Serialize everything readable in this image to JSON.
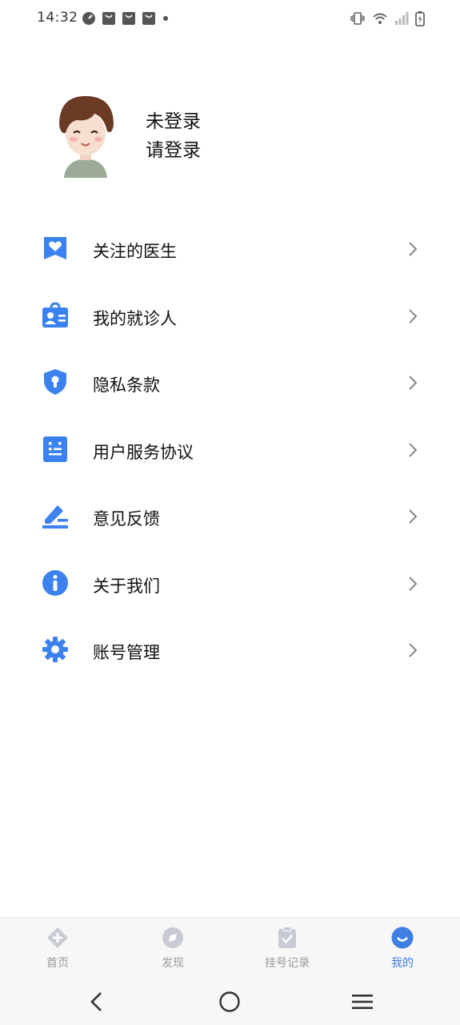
{
  "status_bar": {
    "time": "14:32"
  },
  "profile": {
    "name": "未登录",
    "login_prompt": "请登录"
  },
  "menu": {
    "items": [
      {
        "label": "关注的医生",
        "icon": "heart-bookmark-icon"
      },
      {
        "label": "我的就诊人",
        "icon": "patient-card-icon"
      },
      {
        "label": "隐私条款",
        "icon": "shield-lock-icon"
      },
      {
        "label": "用户服务协议",
        "icon": "agreement-doc-icon"
      },
      {
        "label": "意见反馈",
        "icon": "feedback-edit-icon"
      },
      {
        "label": "关于我们",
        "icon": "info-icon"
      },
      {
        "label": "账号管理",
        "icon": "gear-icon"
      }
    ]
  },
  "tab_bar": {
    "tabs": [
      {
        "label": "首页",
        "icon": "home-plus-icon",
        "active": false
      },
      {
        "label": "发现",
        "icon": "compass-icon",
        "active": false
      },
      {
        "label": "挂号记录",
        "icon": "clipboard-check-icon",
        "active": false
      },
      {
        "label": "我的",
        "icon": "smile-icon",
        "active": true
      }
    ]
  },
  "colors": {
    "accent": "#3f7fe3",
    "icon_blue": "#3b82f0",
    "tab_inactive": "#9a9a9a",
    "text": "#111111"
  }
}
